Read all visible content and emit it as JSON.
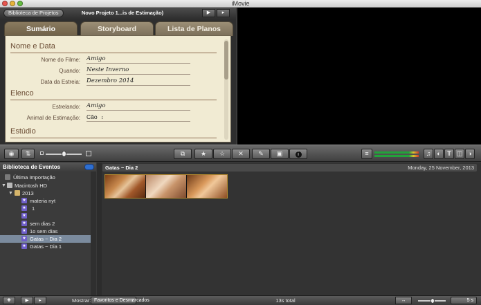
{
  "window": {
    "title": "iMovie",
    "traffic_lights": {
      "close": "#e8564f",
      "minimize": "#e6b43a",
      "zoom": "#67bd43"
    }
  },
  "project": {
    "library_button": "Biblioteca de Projetos",
    "title": "Novo Projeto 1...is de Estimação)",
    "play_fullscreen_icon": "play-fullscreen-icon",
    "play_icon": "play-icon",
    "tabs": [
      {
        "label": "Sumário",
        "active": true
      },
      {
        "label": "Storyboard",
        "active": false
      },
      {
        "label": "Lista de Planos",
        "active": false
      }
    ],
    "sections": {
      "name_date": {
        "heading": "Nome e Data",
        "fields": [
          {
            "label": "Nome do Filme:",
            "value": "Amigo"
          },
          {
            "label": "Quando:",
            "value": "Neste Inverno"
          },
          {
            "label": "Data da Estreia:",
            "value": "Dezembro 2014"
          }
        ]
      },
      "cast": {
        "heading": "Elenco",
        "fields": [
          {
            "label": "Estrelando:",
            "value": "Amigo"
          },
          {
            "label": "Animal de Estimação:",
            "value": "Cão",
            "control": "popup"
          }
        ]
      },
      "studio": {
        "heading": "Estúdio"
      }
    }
  },
  "toolbar": {
    "left_icons": [
      "camera-import-icon",
      "swap-icon"
    ],
    "zoom_icons": [
      "small-thumb-icon",
      "large-thumb-icon"
    ],
    "center_icons": [
      "add-to-project-icon",
      "favorite-star-icon",
      "unmark-star-icon",
      "reject-icon",
      "keyword-icon",
      "crop-icon",
      "info-icon"
    ],
    "right_icons": [
      "audio-meter-icon",
      "music-icon",
      "photo-icon",
      "title-icon",
      "transition-icon",
      "map-icon"
    ]
  },
  "event_library": {
    "title": "Biblioteca de Eventos",
    "items": [
      {
        "label": "Última Importação",
        "icon": "last-import-icon",
        "indent": 0,
        "selected": false
      },
      {
        "label": "Macintosh HD",
        "icon": "hard-drive-icon",
        "indent": 0,
        "selected": false,
        "expanded": true
      },
      {
        "label": "2013",
        "icon": "folder-icon",
        "indent": 1,
        "selected": false,
        "expanded": true
      },
      {
        "label": "materia nyt",
        "icon": "event-star-icon",
        "indent": 2,
        "selected": false
      },
      {
        "label": "1",
        "icon": "event-star-icon",
        "indent": 2,
        "selected": false
      },
      {
        "label": "",
        "icon": "event-star-icon",
        "indent": 2,
        "selected": false
      },
      {
        "label": "sem dias 2",
        "icon": "event-star-icon",
        "indent": 2,
        "selected": false
      },
      {
        "label": "1o sem dias",
        "icon": "event-star-icon",
        "indent": 2,
        "selected": false
      },
      {
        "label": "Gatas ~ Dia 2",
        "icon": "event-star-icon",
        "indent": 2,
        "selected": true
      },
      {
        "label": "Gatas ~ Dia 1",
        "icon": "event-star-icon",
        "indent": 2,
        "selected": false
      }
    ]
  },
  "browser": {
    "event_name": "Gatas ~ Dia 2",
    "date": "Monday, 25 November, 2013",
    "clips": [
      {
        "frames": 3,
        "highlight": "#b38a2e"
      }
    ]
  },
  "bottom": {
    "show_label": "Mostrar:",
    "filter": "Favoritos e Desmarcados",
    "total": "13s total",
    "speed": "5 s"
  }
}
